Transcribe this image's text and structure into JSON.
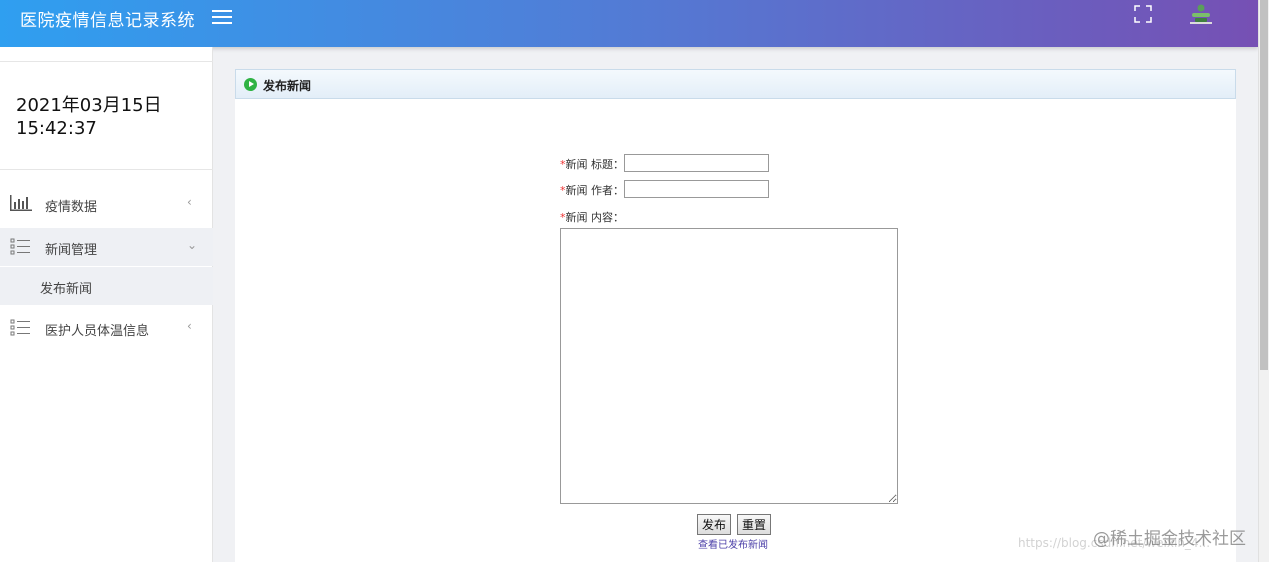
{
  "header": {
    "app_title": "医院疫情信息记录系统",
    "menu_icon": "hamburger-menu-icon",
    "fullscreen_icon": "fullscreen-icon",
    "avatar_icon": "user-avatar-icon"
  },
  "sidebar": {
    "datetime": {
      "date": "2021年03月15日",
      "time": "15:42:37"
    },
    "items": [
      {
        "label": "疫情数据",
        "icon": "bar-chart-icon",
        "arrow": "‹"
      },
      {
        "label": "新闻管理",
        "icon": "list-icon",
        "arrow": "⌄"
      },
      {
        "label": "医护人员体温信息",
        "icon": "list-icon",
        "arrow": "‹"
      }
    ],
    "sub_items": [
      {
        "label": "发布新闻"
      }
    ]
  },
  "panel": {
    "title": "发布新闻",
    "icon": "play-circle-icon"
  },
  "form": {
    "required_mark": "*",
    "title_label": "新闻 标题：",
    "title_value": "",
    "author_label": "新闻 作者：",
    "author_value": "",
    "content_label": "新闻 内容：",
    "content_value": "",
    "publish_button": "发布",
    "reset_button": "重置",
    "view_published_link": "查看已发布新闻"
  },
  "watermark": {
    "url": "https://blog.csdn.net/weixin_4...",
    "brand": "@稀土掘金技术社区"
  },
  "colors": {
    "header_gradient_start": "#2f9ff0",
    "header_gradient_end": "#7650b4",
    "required": "#e33",
    "link": "#4b3fa8",
    "panel_icon": "#2fb344"
  }
}
